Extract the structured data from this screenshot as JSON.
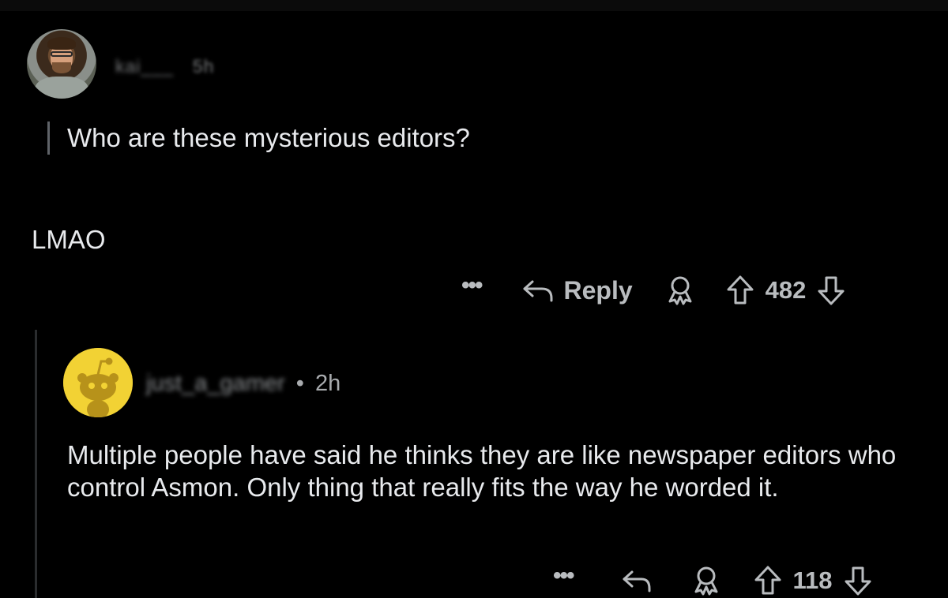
{
  "parent": {
    "username": "kai___",
    "time": "5h",
    "quote": "Who are these mysterious editors?",
    "body": "LMAO",
    "actions": {
      "more": "•••",
      "reply": "Reply",
      "score": "482"
    }
  },
  "child": {
    "username": "just_a_gamer",
    "separator": "•",
    "time": "2h",
    "body": "Multiple people have said he thinks they are like newspaper editors who control Asmon. Only thing that really fits the way he worded it.",
    "actions": {
      "more": "•••",
      "score": "118"
    }
  },
  "icons": {
    "reply": "reply-arrow-icon",
    "award": "award-icon",
    "upvote": "upvote-arrow-icon",
    "downvote": "downvote-arrow-icon",
    "snoo": "snoo-avatar-icon"
  },
  "colors": {
    "background": "#000000",
    "text": "#e8eaed",
    "muted": "#b9bcbf",
    "snoo_yellow": "#f2d234"
  }
}
